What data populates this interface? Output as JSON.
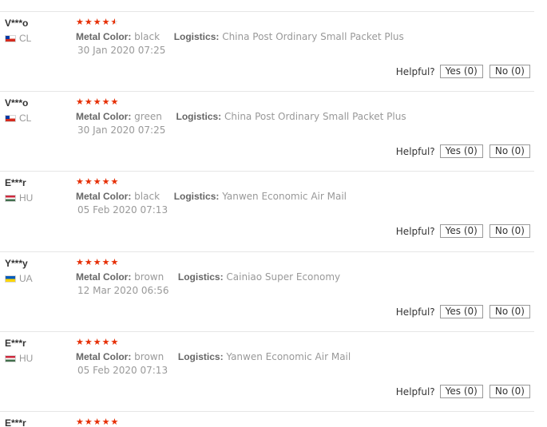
{
  "reviews": [
    {
      "user": "V***o",
      "country": "CL",
      "flag": "chile-flag",
      "rating": 4.5,
      "stars": "★★★★★",
      "metal_color_label": "Metal Color:",
      "metal_color": "black",
      "logistics_label": "Logistics:",
      "logistics": "China Post Ordinary Small Packet Plus",
      "date": "30 Jan 2020 07:25",
      "helpful_label": "Helpful?",
      "yes_label": "Yes (0)",
      "no_label": "No (0)"
    },
    {
      "user": "V***o",
      "country": "CL",
      "flag": "chile-flag",
      "rating": 5,
      "stars": "★★★★★",
      "metal_color_label": "Metal Color:",
      "metal_color": "green",
      "logistics_label": "Logistics:",
      "logistics": "China Post Ordinary Small Packet Plus",
      "date": "30 Jan 2020 07:25",
      "helpful_label": "Helpful?",
      "yes_label": "Yes (0)",
      "no_label": "No (0)"
    },
    {
      "user": "E***r",
      "country": "HU",
      "flag": "hungary-flag",
      "rating": 5,
      "stars": "★★★★★",
      "metal_color_label": "Metal Color:",
      "metal_color": "black",
      "logistics_label": "Logistics:",
      "logistics": "Yanwen Economic Air Mail",
      "date": "05 Feb 2020 07:13",
      "helpful_label": "Helpful?",
      "yes_label": "Yes (0)",
      "no_label": "No (0)"
    },
    {
      "user": "Y***y",
      "country": "UA",
      "flag": "ukraine-flag",
      "rating": 5,
      "stars": "★★★★★",
      "metal_color_label": "Metal Color:",
      "metal_color": "brown",
      "logistics_label": "Logistics:",
      "logistics": "Cainiao Super Economy",
      "date": "12 Mar 2020 06:56",
      "helpful_label": "Helpful?",
      "yes_label": "Yes (0)",
      "no_label": "No (0)"
    },
    {
      "user": "E***r",
      "country": "HU",
      "flag": "hungary-flag",
      "rating": 5,
      "stars": "★★★★★",
      "metal_color_label": "Metal Color:",
      "metal_color": "brown",
      "logistics_label": "Logistics:",
      "logistics": "Yanwen Economic Air Mail",
      "date": "05 Feb 2020 07:13",
      "helpful_label": "Helpful?",
      "yes_label": "Yes (0)",
      "no_label": "No (0)"
    },
    {
      "user": "E***r",
      "stars": "★★★★★"
    }
  ],
  "colors": {
    "star": "#e62e04",
    "divider": "#e6e6e6",
    "muted_text": "#999999"
  }
}
